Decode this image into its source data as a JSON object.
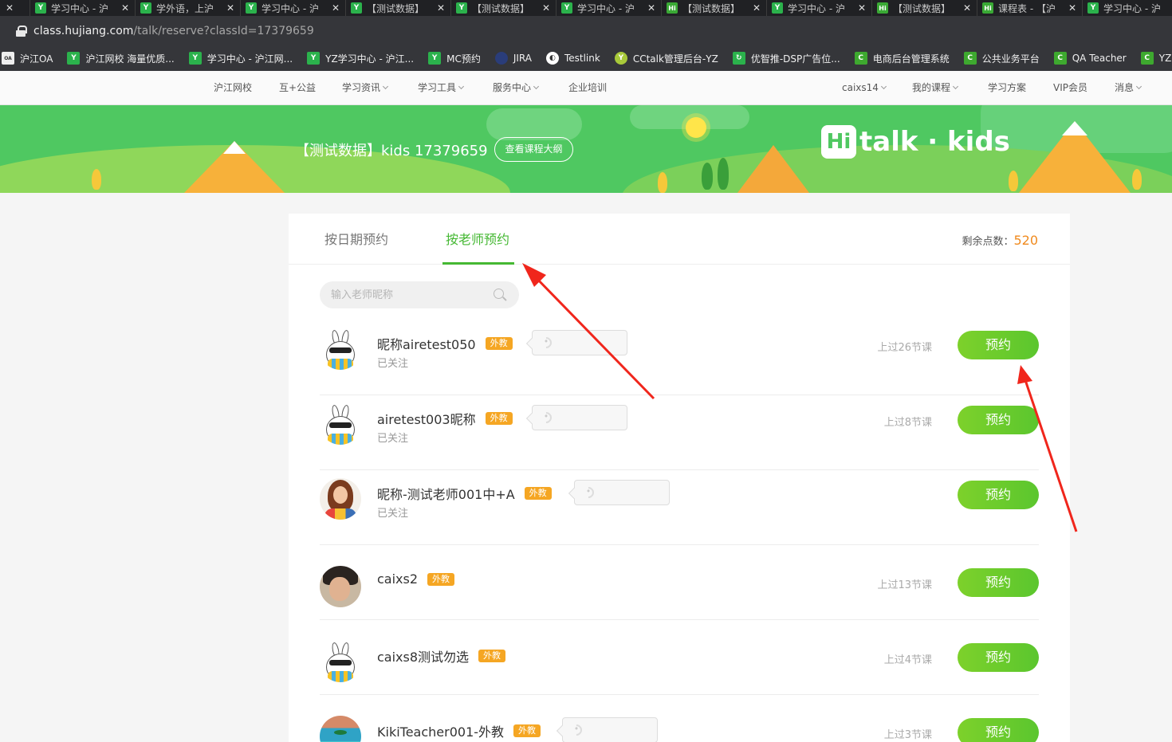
{
  "browser": {
    "tabs": [
      {
        "label": "学习中心 - 沪",
        "favicon": "leaf"
      },
      {
        "label": "学外语，上沪",
        "favicon": "leaf"
      },
      {
        "label": "学习中心 - 沪",
        "favicon": "leaf"
      },
      {
        "label": "【测试数据】",
        "favicon": "leaf"
      },
      {
        "label": "【测试数据】",
        "favicon": "leaf"
      },
      {
        "label": "学习中心 - 沪",
        "favicon": "leaf"
      },
      {
        "label": "【测试数据】",
        "favicon": "hi"
      },
      {
        "label": "学习中心 - 沪",
        "favicon": "leaf"
      },
      {
        "label": "【测试数据】",
        "favicon": "hi"
      },
      {
        "label": "课程表 - 【沪",
        "favicon": "hi"
      },
      {
        "label": "学习中心 - 沪",
        "favicon": "leaf"
      }
    ],
    "url_host": "class.hujiang.com",
    "url_path": "/talk/reserve?classId=17379659",
    "bookmarks": [
      {
        "label": "沪江OA",
        "icon": "oa-icon"
      },
      {
        "label": "沪江网校 海量优质...",
        "icon": "leaf-icon"
      },
      {
        "label": "学习中心 - 沪江网...",
        "icon": "leaf-icon"
      },
      {
        "label": "YZ学习中心 - 沪江...",
        "icon": "leaf-icon"
      },
      {
        "label": "MC预约",
        "icon": "leaf-icon"
      },
      {
        "label": "JIRA",
        "icon": "jira-icon"
      },
      {
        "label": "Testlink",
        "icon": "globe-icon"
      },
      {
        "label": "CCtalk管理后台-YZ",
        "icon": "leaf-icon"
      },
      {
        "label": "优智推-DSP广告位...",
        "icon": "refresh-icon"
      },
      {
        "label": "电商后台管理系统",
        "icon": "cc-icon"
      },
      {
        "label": "公共业务平台",
        "icon": "cc-icon"
      },
      {
        "label": "QA Teacher",
        "icon": "cc-icon"
      },
      {
        "label": "YZ",
        "icon": "cc-icon"
      }
    ]
  },
  "sitenav": {
    "left": [
      "沪江网校",
      "互+公益",
      "学习资讯",
      "学习工具",
      "服务中心",
      "企业培训"
    ],
    "right": [
      "caixs14",
      "我的课程",
      "学习方案",
      "VIP会员",
      "消息"
    ]
  },
  "banner": {
    "course_title": "【测试数据】kids 17379659",
    "syllabus_button": "查看课程大纲",
    "logo_hi": "Hi",
    "logo_text": "talk · kids"
  },
  "reserve": {
    "tab_by_date": "按日期预约",
    "tab_by_teacher": "按老师预约",
    "remaining_label": "剩余点数：",
    "remaining_points": "520",
    "search_placeholder": "输入老师昵称",
    "book_label": "预约",
    "foreign_badge": "外教",
    "teachers": [
      {
        "name": "昵称airetest050",
        "followed": "已关注",
        "lessons": "上过26节课",
        "avatar": "rabbit",
        "audio": true
      },
      {
        "name": "airetest003昵称",
        "followed": "已关注",
        "lessons": "上过8节课",
        "avatar": "rabbit",
        "audio": true
      },
      {
        "name": "昵称-测试老师001中+A",
        "followed": "已关注",
        "lessons": "",
        "avatar": "woman",
        "audio": true
      },
      {
        "name": "caixs2",
        "followed": "",
        "lessons": "上过13节课",
        "avatar": "man",
        "audio": false
      },
      {
        "name": "caixs8测试勿选",
        "followed": "",
        "lessons": "上过4节课",
        "avatar": "rabbit",
        "audio": false
      },
      {
        "name": "KikiTeacher001-外教",
        "followed": "",
        "lessons": "上过3节课",
        "avatar": "beach",
        "audio": true
      }
    ]
  },
  "colors": {
    "accent_green": "#45b833",
    "banner_green": "#4fc861",
    "badge_orange": "#f5a623",
    "points_orange": "#f08a1e",
    "annotation_red": "#f0261c"
  }
}
